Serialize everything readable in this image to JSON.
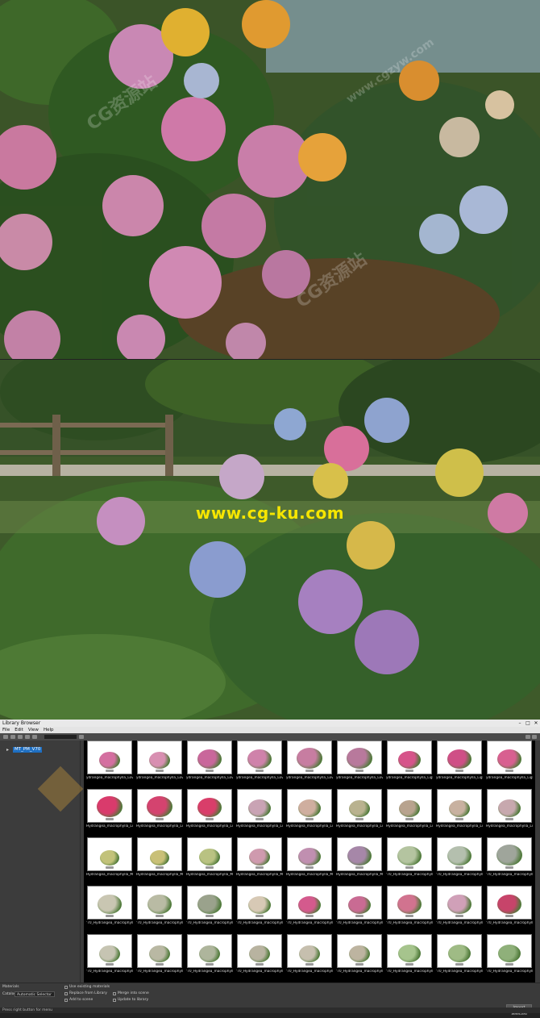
{
  "photo2": {
    "watermark": "www.cg-ku.com"
  },
  "watermarks": {
    "ghost_text": "CG资源站",
    "ghost_url": "www.cgzyw.com"
  },
  "library": {
    "title": "Library Browser",
    "menu": [
      "File",
      "Edit",
      "View",
      "Help"
    ],
    "tree_item": "MT_PM_V70",
    "thumbnails": [
      {
        "caption": "ydrangea_macrophylla_Lovers",
        "color": "#d46fa0",
        "size": 26
      },
      {
        "caption": "ydrangea_macrophylla_Lovers",
        "color": "#d88fb1",
        "size": 26
      },
      {
        "caption": "ydrangea_macrophylla_Lovers",
        "color": "#c9679b",
        "size": 30
      },
      {
        "caption": "ydrangea_macrophylla_Lovers",
        "color": "#cf82aa",
        "size": 30
      },
      {
        "caption": "ydrangea_macrophylla_Lovers",
        "color": "#c77da1",
        "size": 32
      },
      {
        "caption": "ydrangea_macrophylla_Lovers",
        "color": "#b8799c",
        "size": 32
      },
      {
        "caption": "ydrangea_macrophylla_Light",
        "color": "#d6548a",
        "size": 28
      },
      {
        "caption": "ydrangea_macrophylla_Light",
        "color": "#cf4f86",
        "size": 30
      },
      {
        "caption": "ydrangea_macrophylla_Light",
        "color": "#d86090",
        "size": 30
      },
      {
        "caption": "Hydrangea_macrophylla_Light",
        "color": "#d93b6c",
        "size": 32
      },
      {
        "caption": "Hydrangea_macrophylla_Light",
        "color": "#d4436f",
        "size": 32
      },
      {
        "caption": "Hydrangea_macrophylla_Light",
        "color": "#d93e6a",
        "size": 30
      },
      {
        "caption": "Hydrangea_macrophylla_Light",
        "color": "#c9a3b4",
        "size": 28
      },
      {
        "caption": "Hydrangea_macrophylla_Light",
        "color": "#cfae9f",
        "size": 28
      },
      {
        "caption": "Hydrangea_macrophylla_Light",
        "color": "#b9b28f",
        "size": 26
      },
      {
        "caption": "Hydrangea_macrophylla_Light",
        "color": "#b8a38e",
        "size": 26
      },
      {
        "caption": "Hydrangea_macrophylla_Light",
        "color": "#c8b1a0",
        "size": 26
      },
      {
        "caption": "Hydrangea_macrophylla_Light",
        "color": "#c7a8ae",
        "size": 28
      },
      {
        "caption": "Hydrangea_macrophylla_Mini",
        "color": "#c2c27a",
        "size": 24
      },
      {
        "caption": "Hydrangea_macrophylla_Mini",
        "color": "#c9c077",
        "size": 24
      },
      {
        "caption": "Hydrangea_macrophylla_Mini",
        "color": "#b9c282",
        "size": 26
      },
      {
        "caption": "Hydrangea_macrophylla_Mini",
        "color": "#cf9aae",
        "size": 26
      },
      {
        "caption": "Hydrangea_macrophylla_Mini",
        "color": "#c08fb0",
        "size": 28
      },
      {
        "caption": "Hydrangea_macrophylla_Mini",
        "color": "#a687a8",
        "size": 30
      },
      {
        "caption": "'70_Hydrangea_macrophylla_b",
        "color": "#b4c4a0",
        "size": 30
      },
      {
        "caption": "'70_Hydrangea_macrophylla_b",
        "color": "#b4bfae",
        "size": 30
      },
      {
        "caption": "'70_Hydrangea_macrophylla_b",
        "color": "#9fa59b",
        "size": 32
      },
      {
        "caption": "'70_Hydrangea_macrophylla_b",
        "color": "#c9c6b2",
        "size": 30
      },
      {
        "caption": "'70_Hydrangea_macrophylla_b",
        "color": "#b9bba4",
        "size": 30
      },
      {
        "caption": "'70_Hydrangea_macrophylla_b",
        "color": "#9aa28c",
        "size": 30
      },
      {
        "caption": "'70_Hydrangea_macrophylla_Pals",
        "color": "#d7c9b5",
        "size": 28
      },
      {
        "caption": "'70_Hydrangea_macrophylla_Pals",
        "color": "#d45a8d",
        "size": 28
      },
      {
        "caption": "'70_Hydrangea_macrophylla_Pals",
        "color": "#c96b93",
        "size": 28
      },
      {
        "caption": "'70_Hydrangea_macrophylla_PalsW",
        "color": "#d1738f",
        "size": 30
      },
      {
        "caption": "'70_Hydrangea_macrophylla_PalsW",
        "color": "#d0a0b8",
        "size": 30
      },
      {
        "caption": "'70_Hydrangea_macrophylla_PalsW",
        "color": "#c7446a",
        "size": 30
      },
      {
        "caption": "'70_Hydrangea_macrophylla_P",
        "color": "#c6c4b2",
        "size": 26
      },
      {
        "caption": "'70_Hydrangea_macrophylla_P",
        "color": "#b9b8a3",
        "size": 26
      },
      {
        "caption": "'70_Hydrangea_macrophylla_P",
        "color": "#aeb59c",
        "size": 26
      },
      {
        "caption": "'70_Hydrangea_macrophylla_P",
        "color": "#b8b3a0",
        "size": 26
      },
      {
        "caption": "'70_Hydrangea_macrophylla_P",
        "color": "#c6bfae",
        "size": 26
      },
      {
        "caption": "'70_Hydrangea_macrophylla_P",
        "color": "#bdb4a0",
        "size": 26
      },
      {
        "caption": "'70_Hydrangea_macrophylla_Tra",
        "color": "#a6c48d",
        "size": 28
      },
      {
        "caption": "'70_Hydrangea_macrophylla_Tra",
        "color": "#9fbb85",
        "size": 28
      },
      {
        "caption": "'70_Hydrangea_macrophylla_Tra",
        "color": "#8fb07a",
        "size": 28
      }
    ],
    "bottom": {
      "materials_label": "Materials",
      "category_label": "Catalog",
      "selector": "Automatic Selector",
      "checks": [
        "Use existing materials",
        "Replace from Library",
        "Add to scene"
      ],
      "checks_right": [
        "Merge into scene",
        "Update to library"
      ],
      "load_label": "Import Selected"
    },
    "status": "Press right button for menu"
  }
}
